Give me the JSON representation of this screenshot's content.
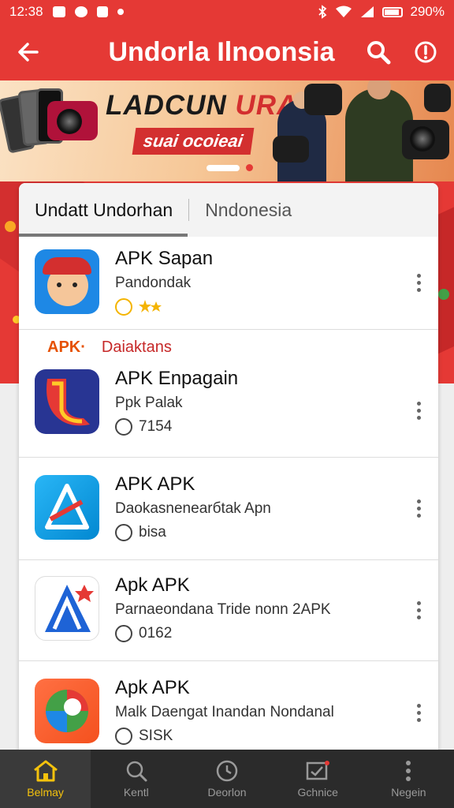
{
  "status_bar": {
    "time": "12:38",
    "battery": "290%"
  },
  "app_bar": {
    "title": "Undorla Ilnoonsia"
  },
  "banner": {
    "headline_a": "LADCUN",
    "headline_b": "URAN",
    "subline": "suai ocoieai"
  },
  "tabs": [
    {
      "label": "Undatt Undorhan",
      "active": true
    },
    {
      "label": "Nndonesia",
      "active": false
    }
  ],
  "apps": [
    {
      "name": "APK Sapan",
      "developer": "Pandondak",
      "meta": ""
    },
    {
      "name": "APK Enpagain",
      "developer": "Ppk Palak",
      "meta": "7154"
    },
    {
      "name": "APK APK",
      "developer": "Daokasnenearбtak Apn",
      "meta": "bisa"
    },
    {
      "name": "Apk APK",
      "developer": "Parnaeondana Tride nonn 2APK",
      "meta": "0162"
    },
    {
      "name": "Apk APK",
      "developer": "Malk Daengat Inandan Nondanal",
      "meta": "SISK"
    }
  ],
  "section": {
    "badge": "APK·",
    "label": "Daiaktans"
  },
  "bottom_nav": [
    {
      "label": "Belmay",
      "icon": "home-icon",
      "active": true
    },
    {
      "label": "Kentl",
      "icon": "search-icon",
      "active": false
    },
    {
      "label": "Deorlon",
      "icon": "clock-icon",
      "active": false
    },
    {
      "label": "Gchnice",
      "icon": "inbox-icon",
      "active": false
    },
    {
      "label": "Negein",
      "icon": "more-vertical-icon",
      "active": false
    }
  ],
  "colors": {
    "primary": "#e53935",
    "accent": "#f4c20d",
    "nav_bg": "#2b2b2b"
  }
}
